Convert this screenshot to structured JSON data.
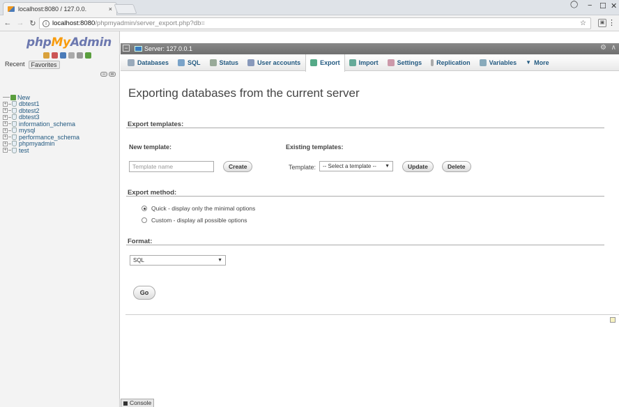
{
  "browser": {
    "tab_title": "localhost:8080 / 127.0.0.",
    "tab_close": "×",
    "url_host": "localhost:8080",
    "url_path": "/phpmyadmin/server_export.php?db=",
    "window_controls": [
      "−",
      "☐",
      "✕"
    ]
  },
  "leftnav": {
    "logo_php": "php",
    "logo_my": "My",
    "logo_admin": "Admin",
    "recent_label": "Recent",
    "favorites_label": "Favorites",
    "new_label": "New",
    "databases": [
      "dbtest1",
      "dbtest2",
      "dbtest3",
      "information_schema",
      "mysql",
      "performance_schema",
      "phpmyadmin",
      "test"
    ]
  },
  "serverbar": {
    "label": "Server: 127.0.0.1"
  },
  "topmenu": {
    "tabs": [
      {
        "label": "Databases",
        "icon": "database-icon",
        "color": "#9ab"
      },
      {
        "label": "SQL",
        "icon": "sql-icon",
        "color": "#7aa3c9"
      },
      {
        "label": "Status",
        "icon": "status-icon",
        "color": "#9a9"
      },
      {
        "label": "User accounts",
        "icon": "users-icon",
        "color": "#89b"
      },
      {
        "label": "Export",
        "icon": "export-icon",
        "color": "#5a8"
      },
      {
        "label": "Import",
        "icon": "import-icon",
        "color": "#6a9"
      },
      {
        "label": "Settings",
        "icon": "settings-icon",
        "color": "#c9a"
      },
      {
        "label": "Replication",
        "icon": "replication-icon",
        "color": "#aaa"
      },
      {
        "label": "Variables",
        "icon": "variables-icon",
        "color": "#8ab"
      },
      {
        "label": "More",
        "icon": "more-icon",
        "color": "#666"
      }
    ],
    "active": "Export"
  },
  "main": {
    "title": "Exporting databases from the current server",
    "export_templates_heading": "Export templates:",
    "new_template_label": "New template:",
    "existing_templates_label": "Existing templates:",
    "template_name_placeholder": "Template name",
    "create_button": "Create",
    "template_label": "Template:",
    "template_select": "-- Select a template --",
    "update_button": "Update",
    "delete_button": "Delete",
    "export_method_heading": "Export method:",
    "method_quick": "Quick - display only the minimal options",
    "method_custom": "Custom - display all possible options",
    "format_heading": "Format:",
    "format_select": "SQL",
    "go_button": "Go"
  },
  "console": {
    "label": "Console"
  }
}
